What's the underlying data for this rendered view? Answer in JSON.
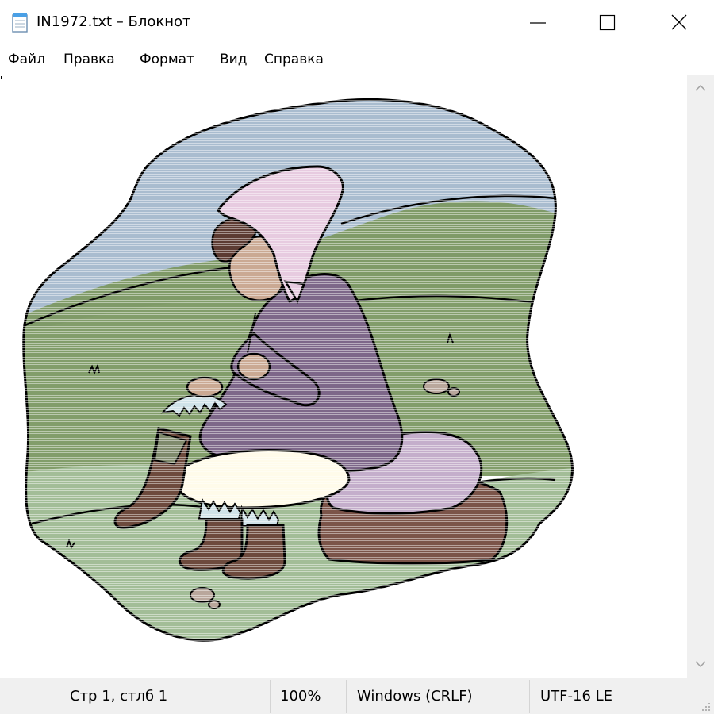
{
  "window": {
    "title": "IN1972.txt – Блокнот",
    "icon": "notepad-icon"
  },
  "menu": {
    "items": [
      "Файл",
      "Правка",
      "Формат",
      "Вид",
      "Справка"
    ]
  },
  "content": {
    "type": "ascii-art-picture",
    "subject": "girl-sewing-fur-boot",
    "colors": {
      "sky": "#a9bccf",
      "grass": "#7f9a68",
      "ground": "#a2bd97",
      "scarf": "#e7cbe0",
      "coat": "#7d6789",
      "boots": "#6d4a3d",
      "rock": "#7b5449",
      "cushion": "#c4aecb",
      "skirt": "#fffbea",
      "skin": "#caa993",
      "hair": "#5c3b32",
      "fur": "#cfe2e8"
    }
  },
  "status": {
    "position": "Стр 1, стлб 1",
    "zoom": "100%",
    "line_ending": "Windows (CRLF)",
    "encoding": "UTF-16 LE"
  },
  "colors": {
    "statusbar_bg": "#f0f0f0",
    "scrollbar_bg": "#f0f0f0",
    "text": "#000000"
  }
}
